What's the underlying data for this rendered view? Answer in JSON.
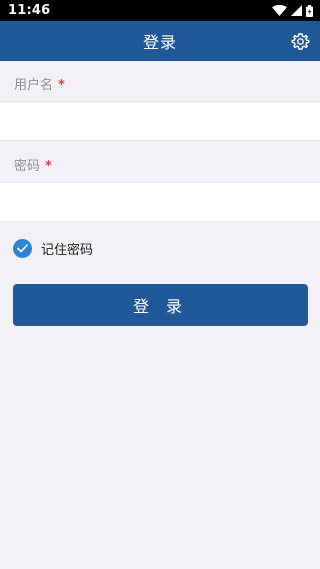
{
  "status_bar": {
    "time": "11:46"
  },
  "app_bar": {
    "title": "登录",
    "settings_icon": "gear-icon"
  },
  "form": {
    "username": {
      "label": "用户名",
      "required_mark": "*",
      "value": "",
      "placeholder": ""
    },
    "password": {
      "label": "密码",
      "required_mark": "*",
      "value": "",
      "placeholder": ""
    },
    "remember": {
      "label": "记住密码",
      "checked": true
    },
    "login_label": "登 录"
  },
  "colors": {
    "primary": "#21589a",
    "checkbox": "#2f83d4",
    "required": "#e23a3a",
    "background": "#f2f1f6"
  }
}
